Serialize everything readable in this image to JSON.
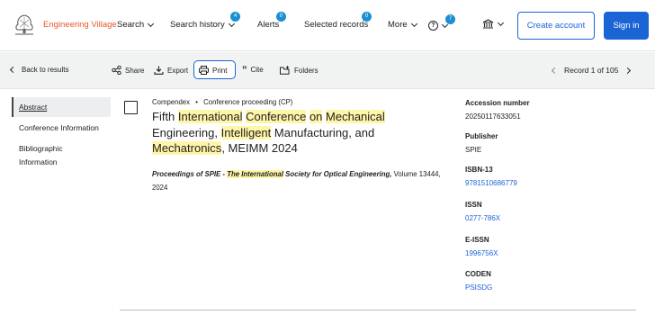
{
  "header": {
    "brand": "Engineering Village",
    "nav": {
      "search": "Search",
      "search_history": "Search history",
      "search_history_badge": "4",
      "alerts": "Alerts",
      "alerts_badge": "0",
      "selected_records": "Selected records",
      "selected_records_badge": "0",
      "more": "More",
      "help_badge": "7"
    },
    "create_account": "Create account",
    "sign_in": "Sign in"
  },
  "toolbar": {
    "back": "Back to results",
    "share": "Share",
    "export": "Export",
    "print": "Print",
    "cite": "Cite",
    "folders": "Folders",
    "record_position": "Record 1 of 105"
  },
  "sidebar": {
    "items": [
      {
        "label": "Abstract"
      },
      {
        "label": "Conference Information"
      },
      {
        "label": "Bibliographic Information"
      }
    ]
  },
  "record": {
    "database": "Compendex",
    "separator": "•",
    "doc_type": "Conference proceeding (CP)",
    "title_parts": [
      "Fifth ",
      "International",
      " ",
      "Conference",
      " ",
      "on",
      " ",
      "Mechanical",
      " Engineering, ",
      "Intelligent",
      " Manufacturing, and ",
      "Mechatronics",
      ", MEIMM 2024"
    ],
    "source_pub_1": "Proceedings of SPIE - ",
    "source_pub_hl": "The International",
    "source_pub_2": " Society for Optical Engineering,",
    "source_rest": " Volume 13444, 2024"
  },
  "details": {
    "accession_label": "Accession number",
    "accession_value": "20250117633051",
    "publisher_label": "Publisher",
    "publisher_value": "SPIE",
    "isbn_label": "ISBN-13",
    "isbn_value": "9781510686779",
    "issn_label": "ISSN",
    "issn_value": "0277-786X",
    "eissn_label": "E-ISSN",
    "eissn_value": "1996756X",
    "coden_label": "CODEN",
    "coden_value": "PSISDG"
  },
  "colors": {
    "brand": "#e8562a",
    "accent": "#1a64d6",
    "badge": "#1a8fd1",
    "highlight": "#fff5a8"
  },
  "icons": [
    "elsevier-logo-icon",
    "chevron-down-icon",
    "help-icon",
    "institution-icon",
    "back-arrow-icon",
    "share-icon",
    "export-icon",
    "print-icon",
    "cite-icon",
    "folder-icon",
    "prev-arrow-icon",
    "next-arrow-icon"
  ]
}
